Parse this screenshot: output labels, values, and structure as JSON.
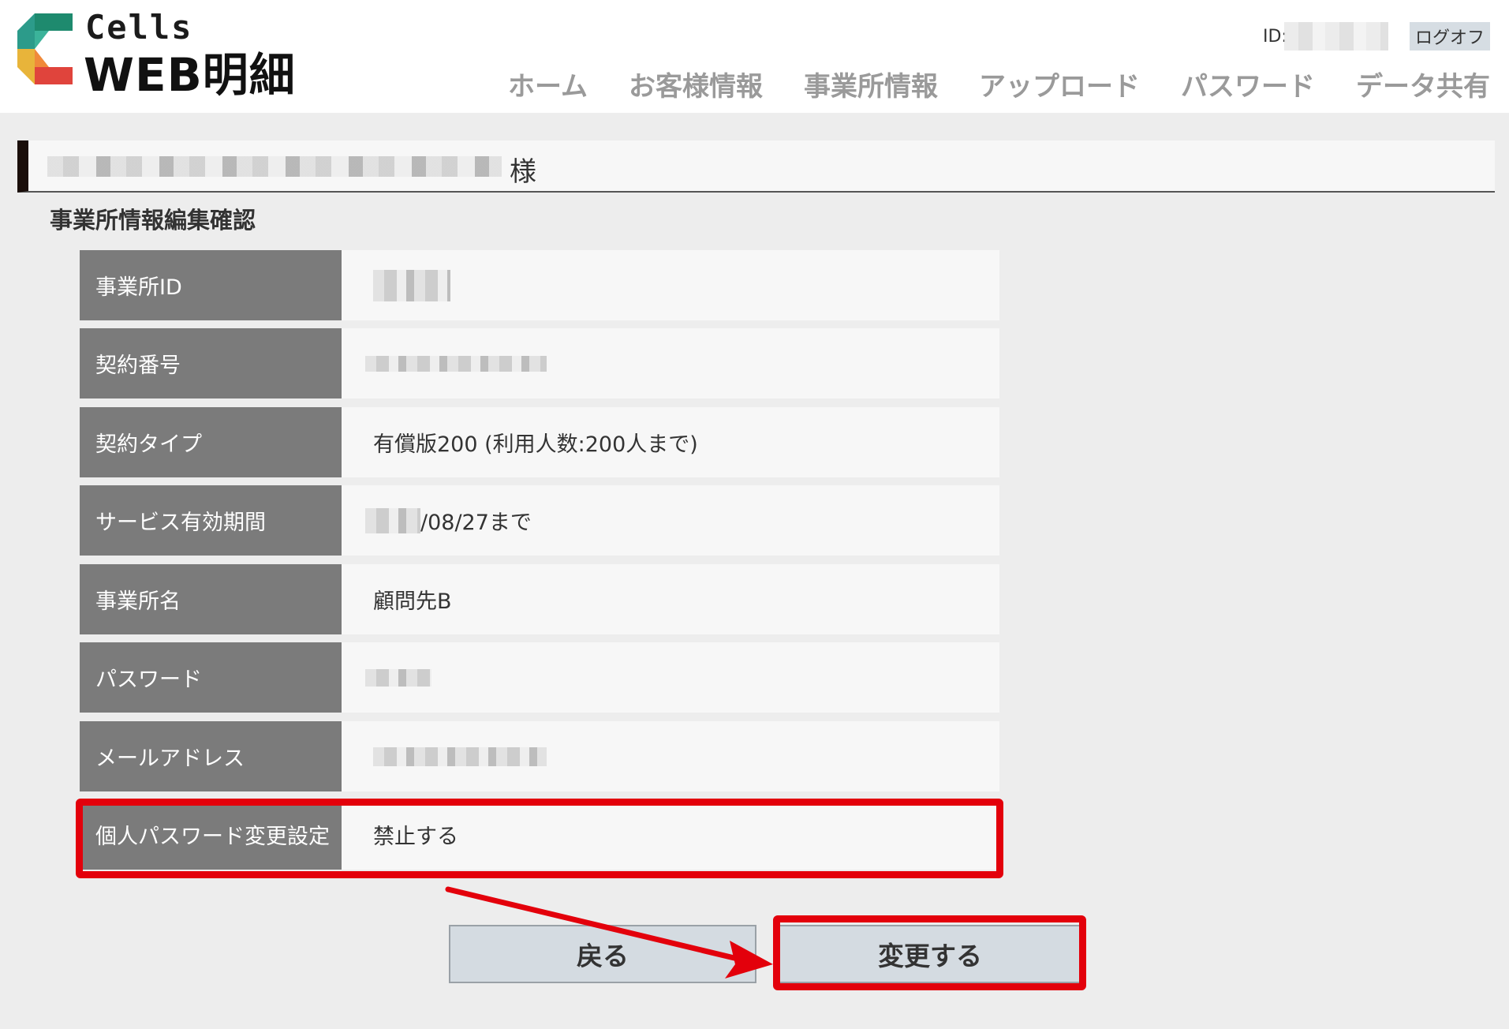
{
  "header": {
    "logo": {
      "line1": "Cells",
      "line2": "WEB明細"
    },
    "id_label": "ID:",
    "logout_label": "ログオフ",
    "nav": [
      "ホーム",
      "お客様情報",
      "事業所情報",
      "アップロード",
      "パスワード",
      "データ共有"
    ]
  },
  "customer": {
    "suffix": "様"
  },
  "page_title": "事業所情報編集確認",
  "rows": [
    {
      "label": "事業所ID",
      "value": ""
    },
    {
      "label": "契約番号",
      "value": ""
    },
    {
      "label": "契約タイプ",
      "value": "有償版200 (利用人数:200人まで)"
    },
    {
      "label": "サービス有効期間",
      "value": "/08/27まで"
    },
    {
      "label": "事業所名",
      "value": "顧問先B"
    },
    {
      "label": "パスワード",
      "value": ""
    },
    {
      "label": "メールアドレス",
      "value": ""
    },
    {
      "label": "個人パスワード変更設定",
      "value": "禁止する"
    }
  ],
  "buttons": {
    "back": "戻る",
    "change": "変更する"
  },
  "colors": {
    "highlight": "#e3000b",
    "label_bg": "#7b7b7b",
    "button_bg": "#d4dbe1"
  }
}
